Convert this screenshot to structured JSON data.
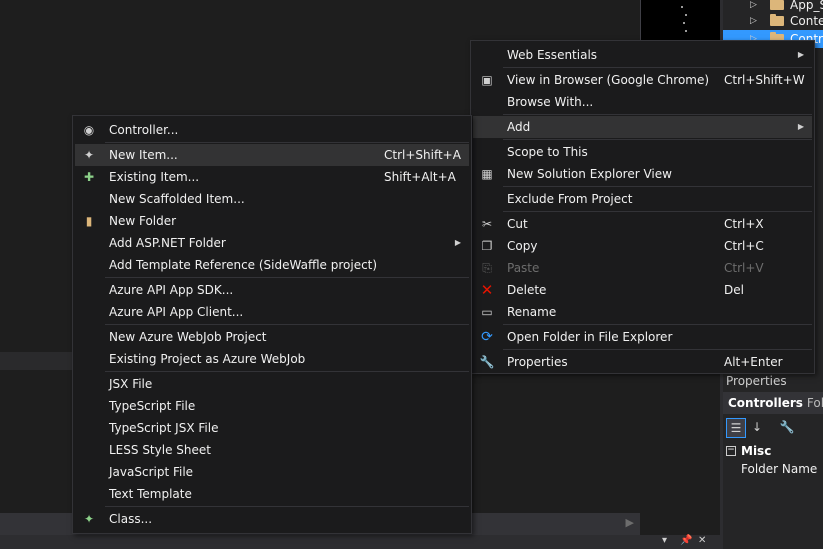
{
  "solution_tree": {
    "items": [
      {
        "label": "App_S",
        "selected": false
      },
      {
        "label": "Conte",
        "selected": false
      },
      {
        "label": "Contro",
        "selected": true
      }
    ]
  },
  "properties": {
    "title": "Properties",
    "object_name": "Controllers",
    "object_type": "Folde",
    "category": "Misc",
    "row_label": "Folder Name"
  },
  "context_menu": {
    "items": [
      {
        "label": "Web Essentials",
        "shortcut": "",
        "submenu": false,
        "icon": ""
      },
      {
        "label": "View in Browser (Google Chrome)",
        "shortcut": "Ctrl+Shift+W",
        "icon": "browser-icon"
      },
      {
        "label": "Browse With...",
        "shortcut": ""
      },
      {
        "label": "Add",
        "shortcut": "",
        "submenu": true,
        "highlighted": true
      },
      {
        "label": "Scope to This",
        "shortcut": ""
      },
      {
        "label": "New Solution Explorer View",
        "shortcut": "",
        "icon": "new-view-icon"
      },
      {
        "label": "Exclude From Project",
        "shortcut": ""
      },
      {
        "label": "Cut",
        "shortcut": "Ctrl+X",
        "icon": "scissors-icon"
      },
      {
        "label": "Copy",
        "shortcut": "Ctrl+C",
        "icon": "copy-icon"
      },
      {
        "label": "Paste",
        "shortcut": "Ctrl+V",
        "icon": "paste-icon",
        "disabled": true
      },
      {
        "label": "Delete",
        "shortcut": "Del",
        "icon": "delete-x-icon"
      },
      {
        "label": "Rename",
        "shortcut": "",
        "icon": "rename-icon"
      },
      {
        "label": "Open Folder in File Explorer",
        "shortcut": "",
        "icon": "refresh-arrow-icon"
      },
      {
        "label": "Properties",
        "shortcut": "Alt+Enter",
        "icon": "wrench-icon"
      }
    ]
  },
  "add_submenu": {
    "items": [
      {
        "label": "Controller...",
        "shortcut": "",
        "icon": "controller-icon"
      },
      {
        "label": "New Item...",
        "shortcut": "Ctrl+Shift+A",
        "icon": "new-item-icon",
        "highlighted": true
      },
      {
        "label": "Existing Item...",
        "shortcut": "Shift+Alt+A",
        "icon": "existing-item-icon"
      },
      {
        "label": "New Scaffolded Item...",
        "shortcut": ""
      },
      {
        "label": "New Folder",
        "shortcut": "",
        "icon": "new-folder-icon"
      },
      {
        "label": "Add ASP.NET Folder",
        "shortcut": "",
        "submenu": true
      },
      {
        "label": "Add Template Reference (SideWaffle project)",
        "shortcut": ""
      },
      {
        "label": "Azure API App SDK...",
        "shortcut": ""
      },
      {
        "label": "Azure API App Client...",
        "shortcut": ""
      },
      {
        "label": "New Azure WebJob Project",
        "shortcut": ""
      },
      {
        "label": "Existing Project as Azure WebJob",
        "shortcut": ""
      },
      {
        "label": "JSX File",
        "shortcut": ""
      },
      {
        "label": "TypeScript File",
        "shortcut": ""
      },
      {
        "label": "TypeScript JSX File",
        "shortcut": ""
      },
      {
        "label": "LESS Style Sheet",
        "shortcut": ""
      },
      {
        "label": "JavaScript File",
        "shortcut": ""
      },
      {
        "label": "Text Template",
        "shortcut": ""
      },
      {
        "label": "Class...",
        "shortcut": "",
        "icon": "class-icon"
      }
    ]
  },
  "colors": {
    "selection": "#3399ff",
    "menu_bg": "#1b1b1c",
    "menu_highlight": "#333334",
    "folder": "#dcb67a",
    "delete": "#e51400"
  }
}
